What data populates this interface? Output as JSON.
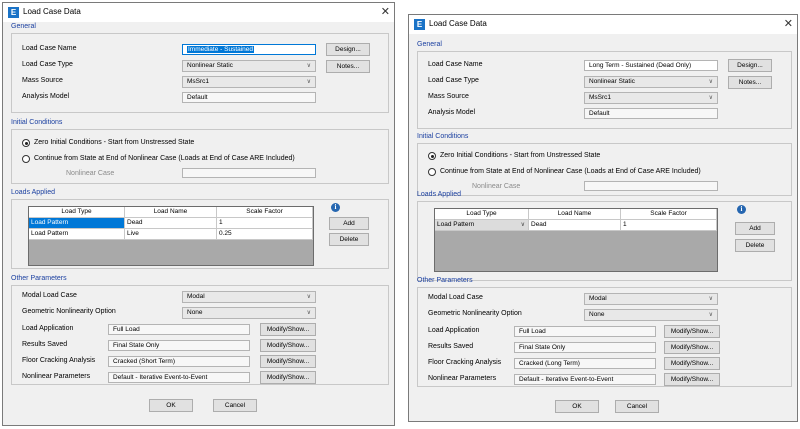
{
  "left": {
    "title": "Load Case Data",
    "general": {
      "label": "General",
      "case_name_label": "Load Case Name",
      "case_name": "Immediate - Sustained",
      "case_type_label": "Load Case Type",
      "case_type": "Nonlinear Static",
      "mass_source_label": "Mass Source",
      "mass_source": "MsSrc1",
      "analysis_model_label": "Analysis Model",
      "analysis_model": "Default",
      "design_button": "Design...",
      "notes_button": "Notes..."
    },
    "initial": {
      "label": "Initial Conditions",
      "option1": "Zero Initial Conditions - Start from Unstressed State",
      "option2": "Continue from State at End of Nonlinear Case  (Loads at End of Case ARE Included)",
      "nonlinear_case_label": "Nonlinear Case"
    },
    "loads": {
      "label": "Loads Applied",
      "headers": [
        "Load Type",
        "Load Name",
        "Scale Factor"
      ],
      "rows": [
        [
          "Load Pattern",
          "Dead",
          "1"
        ],
        [
          "Load Pattern",
          "Live",
          "0.25"
        ]
      ],
      "add_button": "Add",
      "delete_button": "Delete",
      "info_icon": "i"
    },
    "other": {
      "label": "Other Parameters",
      "modal_label": "Modal Load Case",
      "modal": "Modal",
      "geom_label": "Geometric Nonlinearity Option",
      "geom": "None",
      "load_app_label": "Load Application",
      "load_app": "Full Load",
      "results_label": "Results Saved",
      "results": "Final State Only",
      "floor_label": "Floor Cracking Analysis",
      "floor": "Cracked (Short Term)",
      "nonlin_label": "Nonlinear Parameters",
      "nonlin": "Default - Iterative Event-to-Event",
      "modify_button": "Modify/Show..."
    },
    "ok_button": "OK",
    "cancel_button": "Cancel"
  },
  "right": {
    "title": "Load Case Data",
    "general": {
      "label": "General",
      "case_name_label": "Load Case Name",
      "case_name": "Long Term - Sustained (Dead Only)",
      "case_type_label": "Load Case Type",
      "case_type": "Nonlinear Static",
      "mass_source_label": "Mass Source",
      "mass_source": "MsSrc1",
      "analysis_model_label": "Analysis Model",
      "analysis_model": "Default",
      "design_button": "Design...",
      "notes_button": "Notes..."
    },
    "initial": {
      "label": "Initial Conditions",
      "option1": "Zero Initial Conditions - Start from Unstressed State",
      "option2": "Continue from State at End of Nonlinear Case  (Loads at End of Case ARE Included)",
      "nonlinear_case_label": "Nonlinear Case"
    },
    "loads": {
      "label": "Loads Applied",
      "headers": [
        "Load Type",
        "Load Name",
        "Scale Factor"
      ],
      "rows": [
        [
          "Load Pattern",
          "Dead",
          "1"
        ]
      ],
      "add_button": "Add",
      "delete_button": "Delete",
      "info_icon": "i"
    },
    "other": {
      "label": "Other Parameters",
      "modal_label": "Modal Load Case",
      "modal": "Modal",
      "geom_label": "Geometric Nonlinearity Option",
      "geom": "None",
      "load_app_label": "Load Application",
      "load_app": "Full Load",
      "results_label": "Results Saved",
      "results": "Final State Only",
      "floor_label": "Floor Cracking Analysis",
      "floor": "Cracked (Long Term)",
      "nonlin_label": "Nonlinear Parameters",
      "nonlin": "Default - Iterative Event-to-Event",
      "modify_button": "Modify/Show..."
    },
    "ok_button": "OK",
    "cancel_button": "Cancel"
  },
  "app_icon": "E",
  "close_glyph": "✕",
  "chevron_glyph": "∨",
  "colors": {
    "accent": "#0078d7",
    "group_label": "#1a3fa0",
    "info": "#2566b0"
  }
}
